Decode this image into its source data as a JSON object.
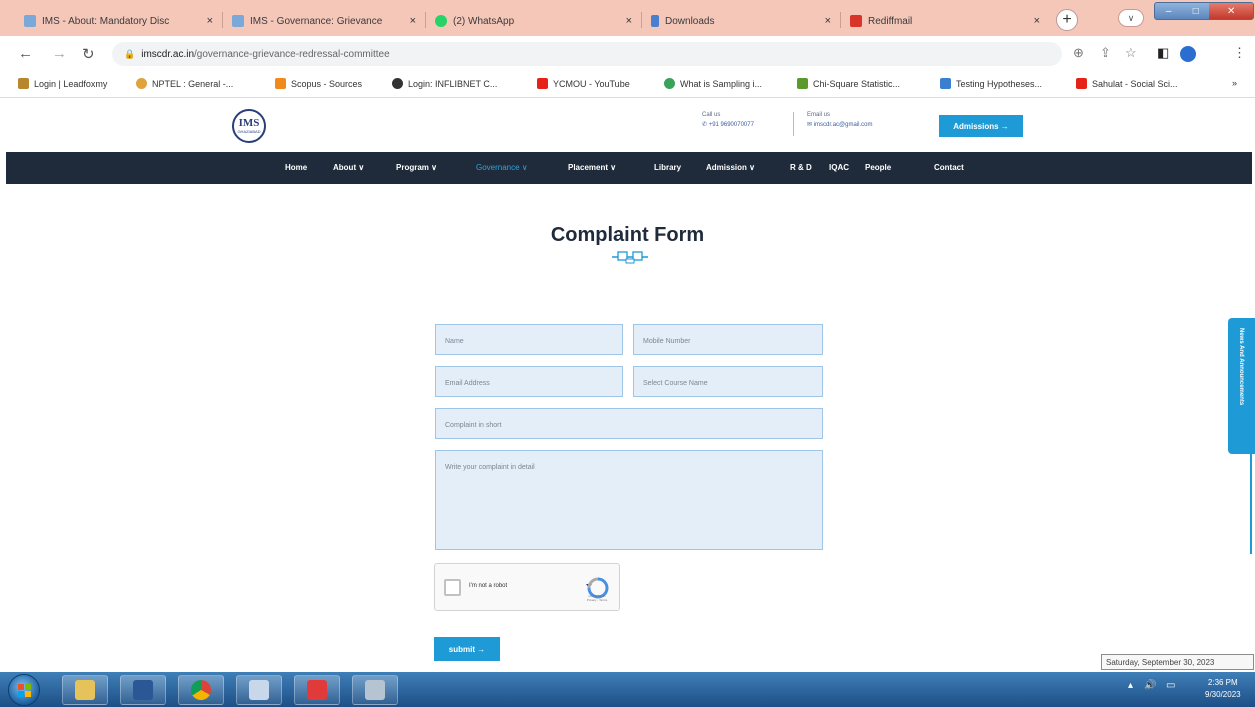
{
  "browser": {
    "tabs": [
      {
        "label": "IMS - About: Mandatory Disc",
        "close": "×"
      },
      {
        "label": "IMS - Governance: Grievance",
        "close": "×"
      },
      {
        "label": "(2) WhatsApp",
        "close": "×"
      },
      {
        "label": "Downloads",
        "close": "×"
      },
      {
        "label": "Rediffmail",
        "close": "×"
      }
    ],
    "new_tab": "+",
    "url_domain": "imscdr.ac.in",
    "url_path": "/governance-grievance-redressal-committee",
    "bookmarks": [
      "Login | Leadfoxmy",
      "NPTEL : General -...",
      "Scopus - Sources",
      "Login: INFLIBNET C...",
      "YCMOU - YouTube",
      "What is Sampling i...",
      "Chi-Square Statistic...",
      "Testing Hypotheses...",
      "Sahulat - Social Sci..."
    ],
    "bookmark_overflow": "»"
  },
  "site": {
    "logo_text": "IMS",
    "logo_sub": "GHAZIABAD",
    "call_label": "Call us",
    "call_value": "+91 9690070077",
    "email_label": "Email us",
    "email_value": "imscdr.ac@gmail.com",
    "admissions_button": "Admissions →",
    "nav": [
      "Home",
      "About ∨",
      "Program ∨",
      "Governance ∨",
      "Placement ∨",
      "Library",
      "Admission ∨",
      "R & D",
      "IQAC",
      "People",
      "Contact"
    ]
  },
  "form": {
    "title": "Complaint Form",
    "name_placeholder": "Name",
    "mobile_placeholder": "Mobile Number",
    "email_placeholder": "Email Address",
    "course_placeholder": "Select Course Name",
    "short_placeholder": "Complaint in short",
    "detail_placeholder": "Write your complaint in detail",
    "captcha_label": "I'm not a robot",
    "captcha_brand": "reCAPTCHA",
    "captcha_terms": "Privacy - Terms",
    "submit_label": "submit →"
  },
  "side_tab": "News And Announcements",
  "tooltip": "Saturday, September 30, 2023",
  "taskbar": {
    "time": "2:36 PM",
    "date": "9/30/2023"
  },
  "colors": {
    "tab_bg": "#f4c7b9",
    "nav_bg": "#1f2b3a",
    "accent": "#1e9ad6",
    "field_bg": "#e4eef8",
    "field_border": "#9fc6e6"
  }
}
